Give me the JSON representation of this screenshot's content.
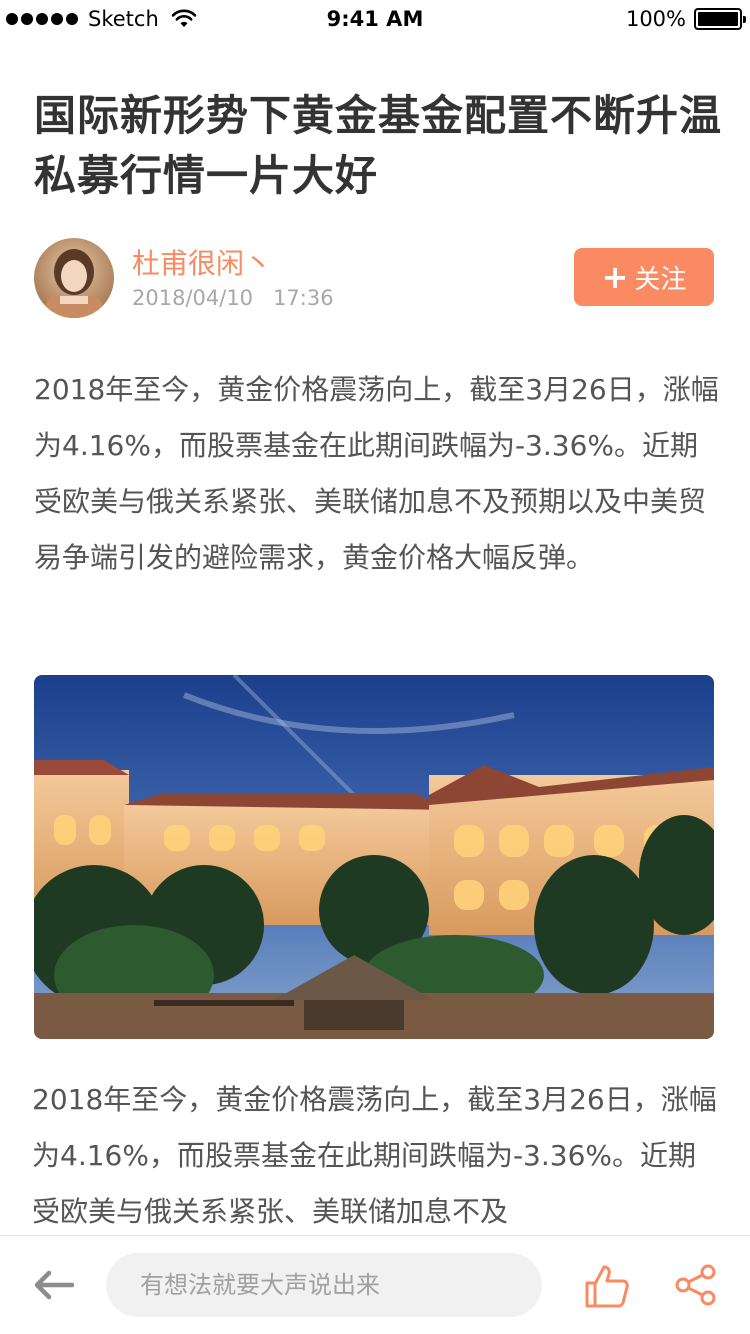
{
  "status_bar": {
    "carrier": "Sketch",
    "time": "9:41 AM",
    "battery": "100%"
  },
  "article": {
    "title": "国际新形势下黄金基金配置不断升温私募行情一片大好",
    "author": "杜甫很闲丶",
    "date": "2018/04/10   17:36",
    "follow_label": "关注",
    "paragraph_1": "2018年至今，黄金价格震荡向上，截至3月26日，涨幅为4.16%，而股票基金在此期间跌幅为-3.36%。近期受欧美与俄关系紧张、美联储加息不及预期以及中美贸易争端引发的避险需求，黄金价格大幅反弹。",
    "paragraph_2": "2018年至今，黄金价格震荡向上，截至3月26日，涨幅为4.16%，而股票基金在此期间跌幅为-3.36%。近期受欧美与俄关系紧张、美联储加息不及"
  },
  "bottom_bar": {
    "comment_placeholder": "有想法就要大声说出来"
  },
  "colors": {
    "accent": "#f98a61",
    "title": "#333333",
    "body_text": "#555555",
    "muted": "#a8a8a8"
  },
  "icons": [
    "wifi-icon",
    "battery-icon",
    "plus-icon",
    "back-arrow-icon",
    "like-icon",
    "share-icon"
  ]
}
